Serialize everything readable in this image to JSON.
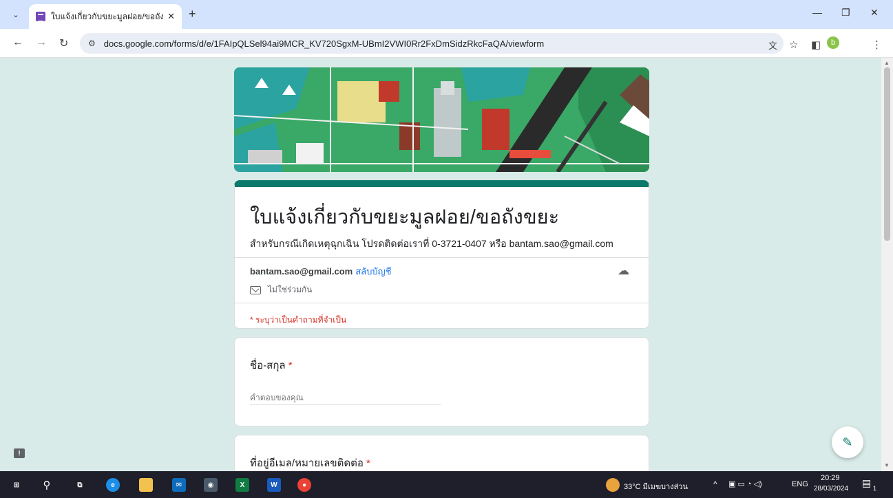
{
  "browser": {
    "tab_title": "ใบแจ้งเกี่ยวกับขยะมูลฝอย/ขอถังขยะ",
    "tab_close": "✕",
    "new_tab": "+",
    "url": "docs.google.com/forms/d/e/1FAIpQLSel94ai9MCR_KV720SgxM-UBmI2VWI0Rr2FxDmSidzRkcFaQA/viewform",
    "profile_initial": "b"
  },
  "form": {
    "title": "ใบแจ้งเกี่ยวกับขยะมูลฝอย/ขอถังขยะ",
    "description": "สำหรับกรณีเกิดเหตุฉุกเฉิน โปรดติดต่อเราที่ 0-3721-0407  หรือ bantam.sao@gmail.com",
    "account_email": "bantam.sao@gmail.com",
    "switch_account": "สลับบัญชี",
    "not_shared": "ไม่ใช่ร่วมกัน",
    "required_note": "* ระบุว่าเป็นคำถามที่จำเป็น",
    "questions": [
      {
        "label": "ชื่อ-สกุล",
        "required_mark": "*",
        "placeholder": "คำตอบของคุณ"
      },
      {
        "label": "ที่อยู่อีเมล/หมายเลขติดต่อ",
        "required_mark": "*"
      }
    ]
  },
  "taskbar": {
    "weather": "33°C  มีเมฆบางส่วน",
    "language": "ENG",
    "time": "20:29",
    "date": "28/03/2024",
    "notification_count": "1"
  },
  "colors": {
    "theme": "#0b7a6a",
    "background": "#d9ebe8",
    "required": "#d93025",
    "link": "#1a73e8"
  }
}
